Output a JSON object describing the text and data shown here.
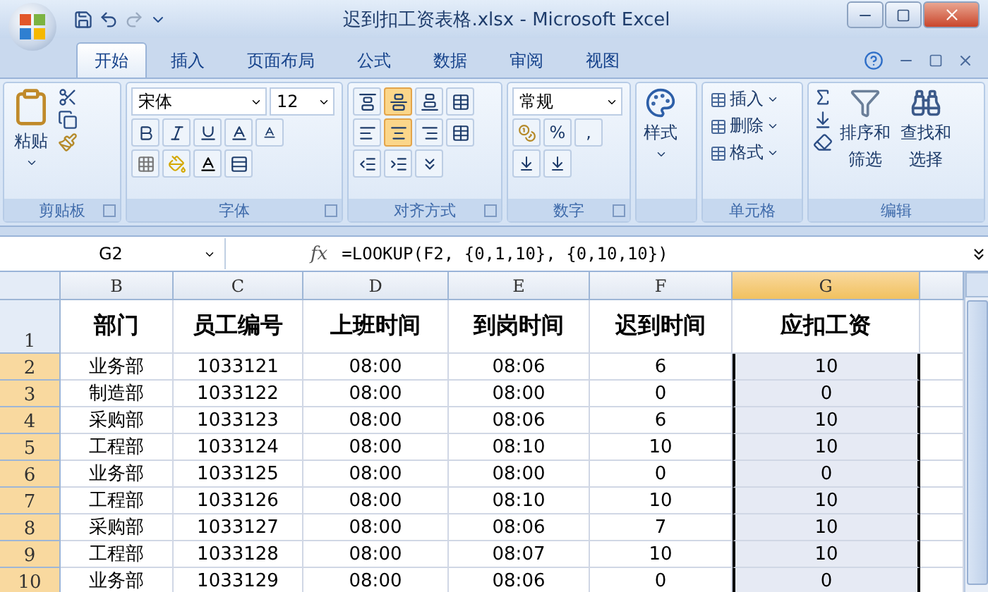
{
  "window": {
    "title": "迟到扣工资表格.xlsx - Microsoft Excel"
  },
  "tabs": [
    {
      "label": "开始",
      "selected": true
    },
    {
      "label": "插入",
      "selected": false
    },
    {
      "label": "页面布局",
      "selected": false
    },
    {
      "label": "公式",
      "selected": false
    },
    {
      "label": "数据",
      "selected": false
    },
    {
      "label": "审阅",
      "selected": false
    },
    {
      "label": "视图",
      "selected": false
    }
  ],
  "ribbon": {
    "clipboard": {
      "label": "剪贴板",
      "paste": "粘贴"
    },
    "font": {
      "label": "字体",
      "name": "宋体",
      "size": "12"
    },
    "alignment": {
      "label": "对齐方式",
      "buttons": [
        {
          "kind": "top",
          "selected": false
        },
        {
          "kind": "middle",
          "selected": true
        },
        {
          "kind": "bottom",
          "selected": false
        },
        {
          "kind": "left",
          "selected": false
        },
        {
          "kind": "center",
          "selected": true
        },
        {
          "kind": "right",
          "selected": false
        }
      ]
    },
    "number": {
      "label": "数字",
      "format": "常规",
      "percent": "%",
      "comma": ","
    },
    "styles": {
      "label": "样式"
    },
    "cells": {
      "label": "单元格",
      "items": [
        "插入",
        "删除",
        "格式"
      ]
    },
    "editing": {
      "label": "编辑",
      "sort": [
        "排序和",
        "筛选"
      ],
      "find": [
        "查找和",
        "选择"
      ]
    }
  },
  "formula_bar": {
    "name_box": "G2",
    "function_label": "fx",
    "formula": "=LOOKUP(F2, {0,1,10}, {0,10,10})"
  },
  "sheet": {
    "columns": [
      {
        "label": "B",
        "selected": false
      },
      {
        "label": "C",
        "selected": false
      },
      {
        "label": "D",
        "selected": false
      },
      {
        "label": "E",
        "selected": false
      },
      {
        "label": "F",
        "selected": false
      },
      {
        "label": "G",
        "selected": true
      }
    ],
    "rows": [
      {
        "number": "1",
        "selected": false,
        "cells": [
          "部门",
          "员工编号",
          "上班时间",
          "到岗时间",
          "迟到时间",
          "应扣工资"
        ]
      },
      {
        "number": "2",
        "selected": true,
        "cells": [
          "业务部",
          "1033121",
          "08:00",
          "08:06",
          "6",
          "10"
        ]
      },
      {
        "number": "3",
        "selected": true,
        "cells": [
          "制造部",
          "1033122",
          "08:00",
          "08:00",
          "0",
          "0"
        ]
      },
      {
        "number": "4",
        "selected": true,
        "cells": [
          "采购部",
          "1033123",
          "08:00",
          "08:06",
          "6",
          "10"
        ]
      },
      {
        "number": "5",
        "selected": true,
        "cells": [
          "工程部",
          "1033124",
          "08:00",
          "08:10",
          "10",
          "10"
        ]
      },
      {
        "number": "6",
        "selected": true,
        "cells": [
          "业务部",
          "1033125",
          "08:00",
          "08:00",
          "0",
          "0"
        ]
      },
      {
        "number": "7",
        "selected": true,
        "cells": [
          "工程部",
          "1033126",
          "08:00",
          "08:10",
          "10",
          "10"
        ]
      },
      {
        "number": "8",
        "selected": true,
        "cells": [
          "采购部",
          "1033127",
          "08:00",
          "08:06",
          "7",
          "10"
        ]
      },
      {
        "number": "9",
        "selected": true,
        "cells": [
          "工程部",
          "1033128",
          "08:00",
          "08:07",
          "10",
          "10"
        ]
      },
      {
        "number": "10",
        "selected": true,
        "cells": [
          "业务部",
          "1033129",
          "08:00",
          "08:06",
          "0",
          "0"
        ]
      }
    ]
  }
}
